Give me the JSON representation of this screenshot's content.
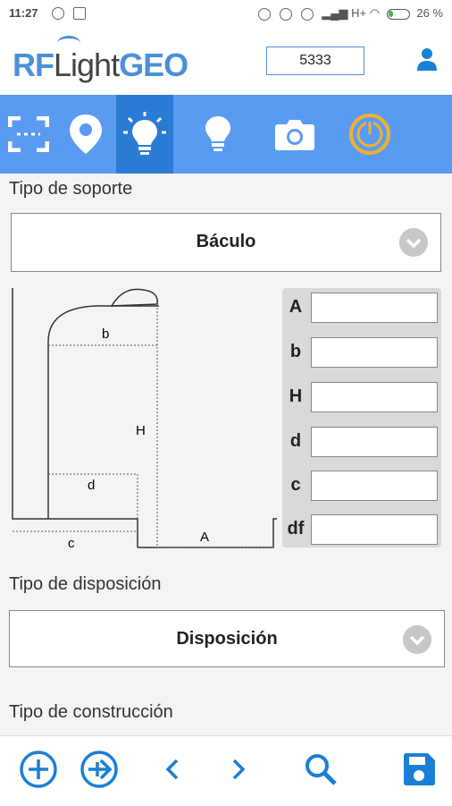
{
  "status_bar": {
    "time": "11:27",
    "network": "H+",
    "battery_text": "26 %",
    "battery_level": 0.26
  },
  "header": {
    "logo_rf": "RF",
    "logo_light": "Light",
    "logo_geo": "GEO",
    "code": "5333"
  },
  "toolbar": {
    "items": [
      {
        "icon": "scan-frame-icon",
        "active": false
      },
      {
        "icon": "map-pin-icon",
        "active": false
      },
      {
        "icon": "lit-bulb-icon",
        "active": true
      },
      {
        "icon": "bulb-icon",
        "active": false
      },
      {
        "icon": "camera-icon",
        "active": false
      },
      {
        "icon": "power-icon",
        "active": false
      }
    ]
  },
  "soporte": {
    "label": "Tipo de soporte",
    "value": "Báculo"
  },
  "diagram": {
    "labels": {
      "b": "b",
      "H": "H",
      "d": "d",
      "c": "c",
      "A": "A"
    }
  },
  "dimensions": [
    {
      "label": "A",
      "value": ""
    },
    {
      "label": "b",
      "value": ""
    },
    {
      "label": "H",
      "value": ""
    },
    {
      "label": "d",
      "value": ""
    },
    {
      "label": "c",
      "value": ""
    },
    {
      "label": "df",
      "value": ""
    }
  ],
  "disposicion": {
    "label": "Tipo de disposición",
    "value": "Disposición"
  },
  "construccion": {
    "label": "Tipo de construcción"
  },
  "colors": {
    "accent": "#5a9bf2",
    "accent_active": "#2a7bd3",
    "nav_icon": "#1a7fd6",
    "power": "#f0b030"
  }
}
